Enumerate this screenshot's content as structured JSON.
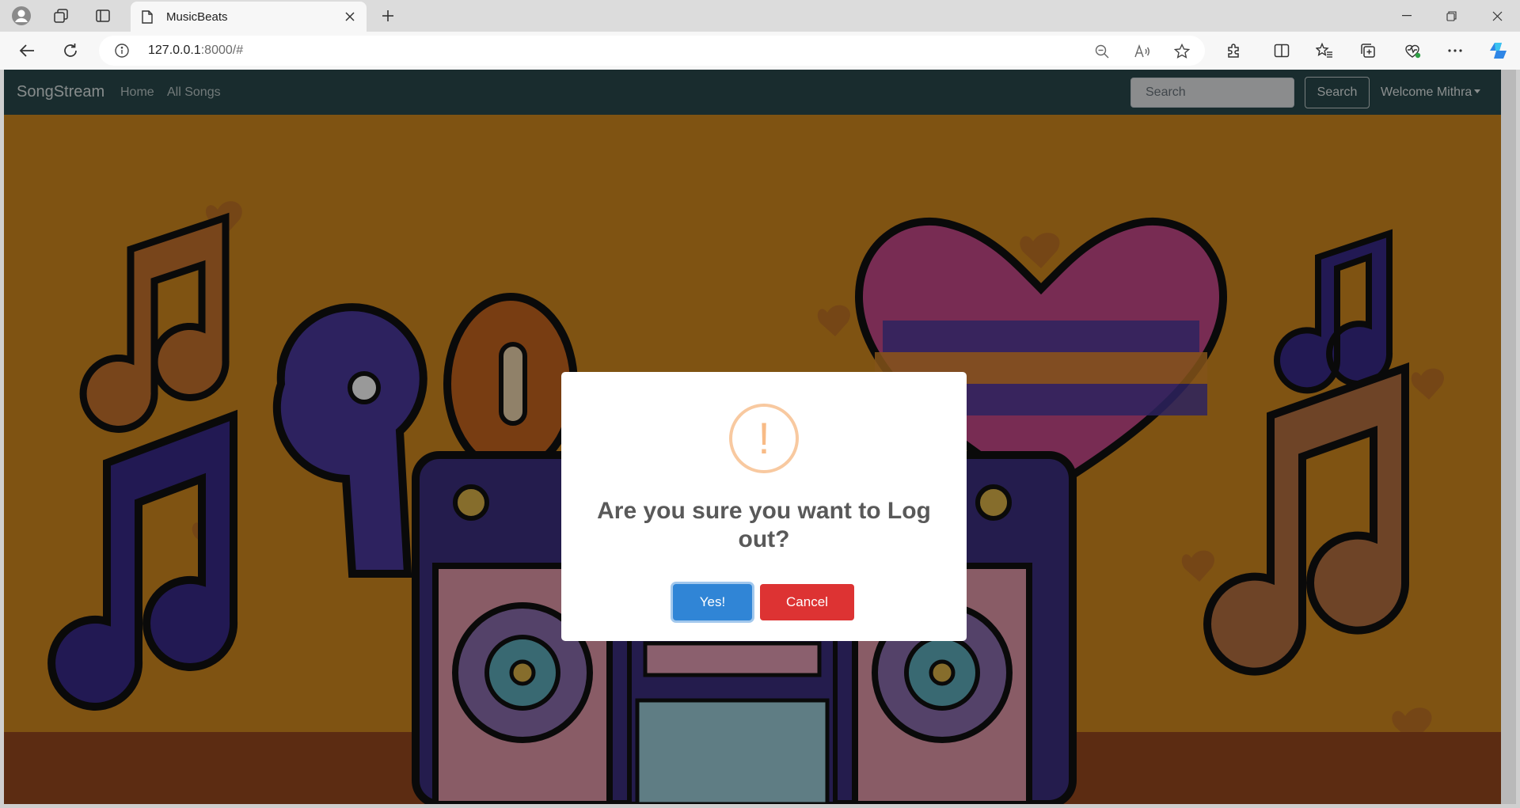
{
  "browser": {
    "tab_title": "MusicBeats",
    "url_host": "127.0.0.1",
    "url_rest": ":8000/#"
  },
  "navbar": {
    "brand": "SongStream",
    "links": [
      "Home",
      "All Songs"
    ],
    "search_placeholder": "Search",
    "search_button": "Search",
    "user_menu": "Welcome Mithra"
  },
  "modal": {
    "icon": "!",
    "title": "Are you sure you want to Log out?",
    "confirm_label": "Yes!",
    "cancel_label": "Cancel"
  },
  "colors": {
    "navbar_bg": "#2a4a4d",
    "hero_bg": "#d48a1f",
    "confirm": "#3085d6",
    "cancel": "#dd3333",
    "warning_icon": "#f8bb86"
  }
}
